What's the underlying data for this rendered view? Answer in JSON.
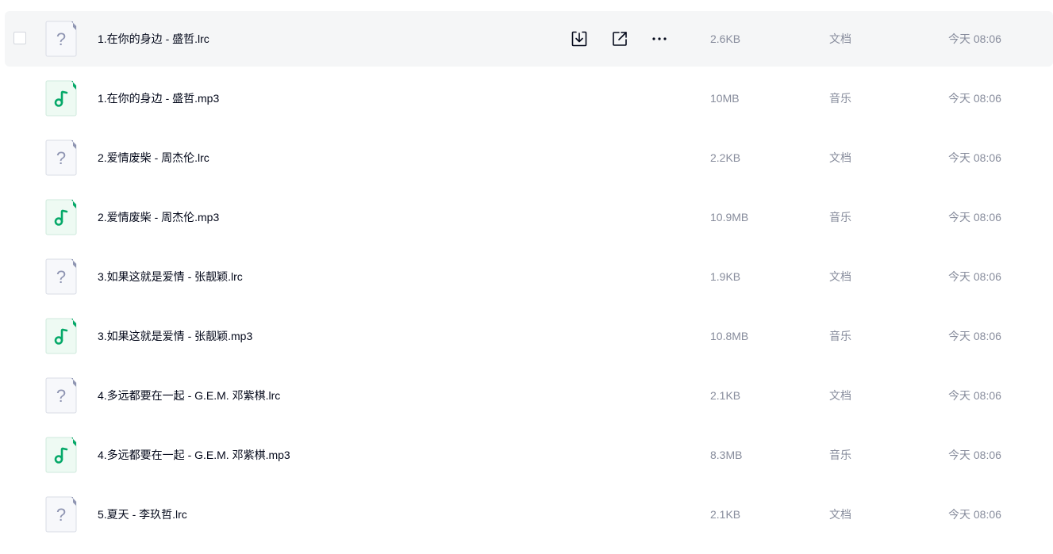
{
  "files": [
    {
      "name": "1.在你的身边 - 盛哲.lrc",
      "size": "2.6KB",
      "type": "文档",
      "time": "今天 08:06",
      "icon": "unknown-file-icon"
    },
    {
      "name": "1.在你的身边 - 盛哲.mp3",
      "size": "10MB",
      "type": "音乐",
      "time": "今天 08:06",
      "icon": "music-file-icon"
    },
    {
      "name": "2.爱情废柴 - 周杰伦.lrc",
      "size": "2.2KB",
      "type": "文档",
      "time": "今天 08:06",
      "icon": "unknown-file-icon"
    },
    {
      "name": "2.爱情废柴 - 周杰伦.mp3",
      "size": "10.9MB",
      "type": "音乐",
      "time": "今天 08:06",
      "icon": "music-file-icon"
    },
    {
      "name": "3.如果这就是爱情 - 张靓颖.lrc",
      "size": "1.9KB",
      "type": "文档",
      "time": "今天 08:06",
      "icon": "unknown-file-icon"
    },
    {
      "name": "3.如果这就是爱情 - 张靓颖.mp3",
      "size": "10.8MB",
      "type": "音乐",
      "time": "今天 08:06",
      "icon": "music-file-icon"
    },
    {
      "name": "4.多远都要在一起 - G.E.M. 邓紫棋.lrc",
      "size": "2.1KB",
      "type": "文档",
      "time": "今天 08:06",
      "icon": "unknown-file-icon"
    },
    {
      "name": "4.多远都要在一起 - G.E.M. 邓紫棋.mp3",
      "size": "8.3MB",
      "type": "音乐",
      "time": "今天 08:06",
      "icon": "music-file-icon"
    },
    {
      "name": "5.夏天 - 李玖哲.lrc",
      "size": "2.1KB",
      "type": "文档",
      "time": "今天 08:06",
      "icon": "unknown-file-icon"
    }
  ],
  "hovered_row": 0,
  "row_actions": [
    "download-icon",
    "share-icon",
    "more-icon"
  ],
  "colors": {
    "music_green": "#06a969",
    "doc_gray": "#8f95b2",
    "text_primary": "#03081a",
    "text_secondary": "#878c9c",
    "hover_bg": "#f5f6f7"
  }
}
